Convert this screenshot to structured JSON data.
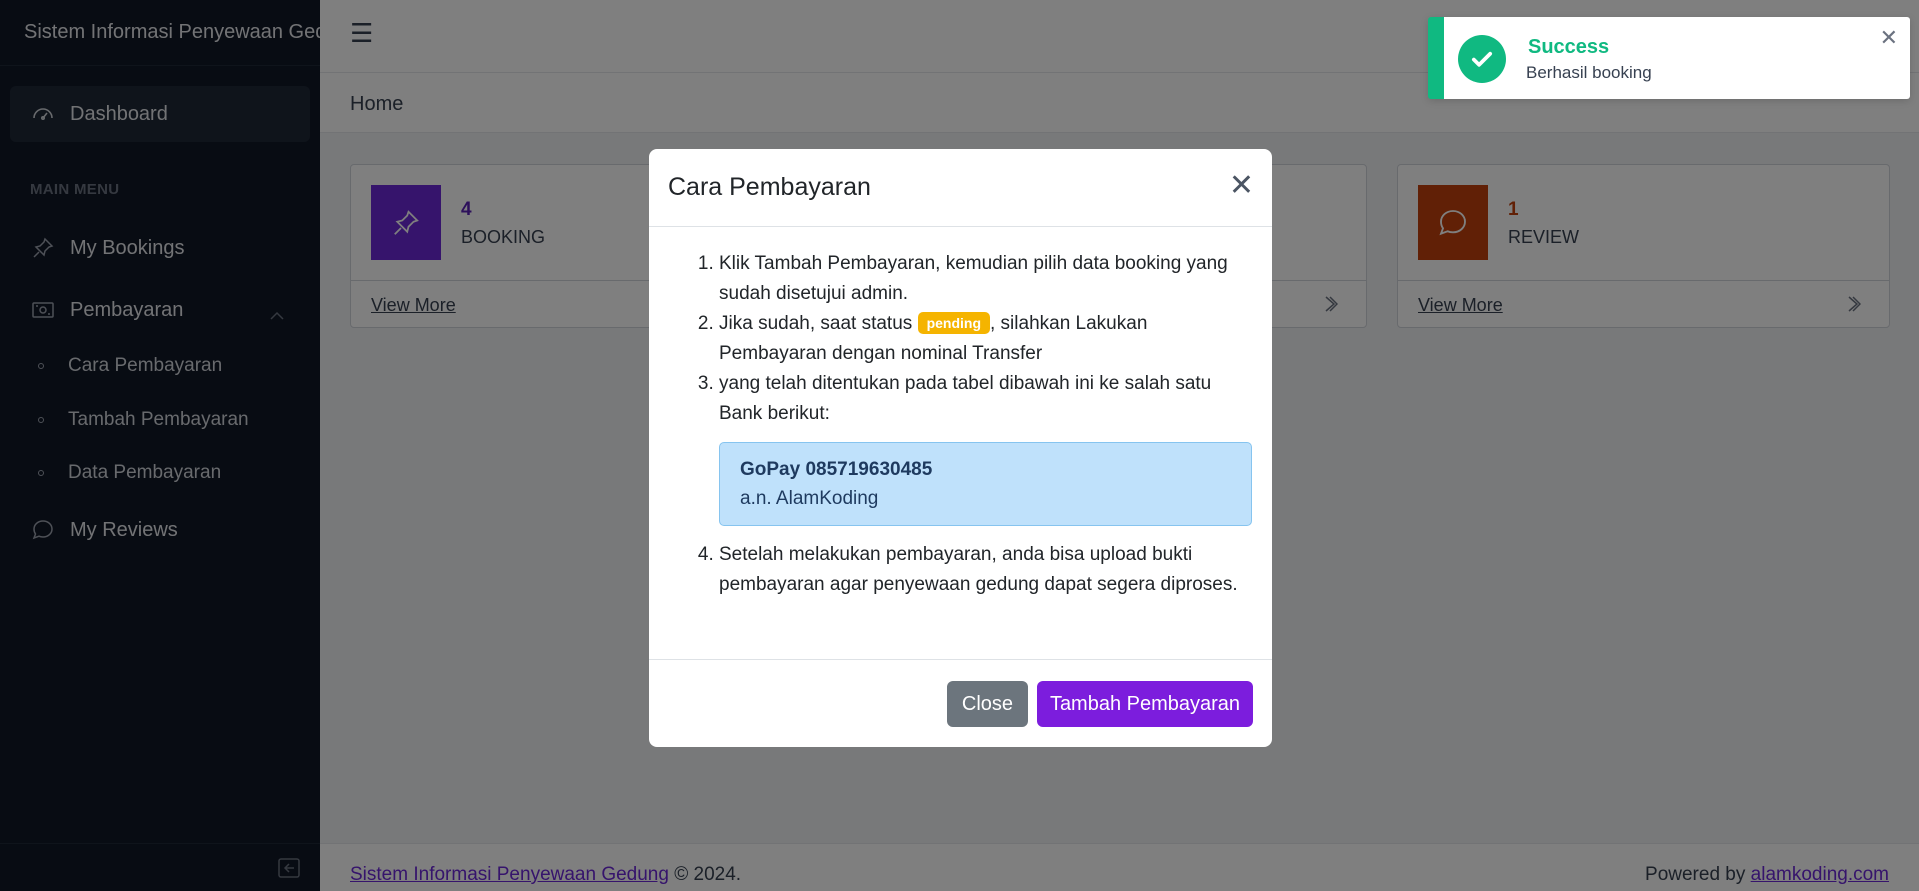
{
  "app": {
    "title": "Sistem Informasi Penyewaan Gedung"
  },
  "sidebar": {
    "dashboard": "Dashboard",
    "section": "MAIN MENU",
    "items": [
      {
        "label": "My Bookings",
        "icon": "pin-icon"
      },
      {
        "label": "Pembayaran",
        "icon": "payment-icon"
      },
      {
        "label": "My Reviews",
        "icon": "chat-icon"
      }
    ],
    "sub": [
      "Cara Pembayaran",
      "Tambah Pembayaran",
      "Data Pembayaran"
    ]
  },
  "breadcrumb": "Home",
  "cards": [
    {
      "num": "4",
      "label": "BOOKING",
      "more": "View More",
      "color": "#5b21b6"
    },
    {
      "num": "1",
      "label": "REVIEW",
      "more": "View More",
      "color": "#c2410c"
    }
  ],
  "footer": {
    "copyright_link": "Sistem Informasi Penyewaan Gedung",
    "copyright_suffix": " © 2024.",
    "powered": "Powered by ",
    "powered_link": "alamkoding.com"
  },
  "modal": {
    "title": "Cara Pembayaran",
    "step1": "Klik Tambah Pembayaran, kemudian pilih data booking yang sudah disetujui admin.",
    "step2_a": "Jika sudah, saat status ",
    "step2_badge": "pending",
    "step2_b": ", silahkan Lakukan Pembayaran dengan nominal Transfer",
    "step3": "yang telah ditentukan pada tabel dibawah ini ke salah satu Bank berikut:",
    "bank_name": "GoPay 085719630485",
    "bank_owner": "a.n. AlamKoding",
    "step4": "Setelah melakukan pembayaran, anda bisa upload bukti pembayaran agar penyewaan gedung dapat segera diproses.",
    "close": "Close",
    "add": "Tambah Pembayaran"
  },
  "toast": {
    "title": "Success",
    "message": "Berhasil booking"
  }
}
